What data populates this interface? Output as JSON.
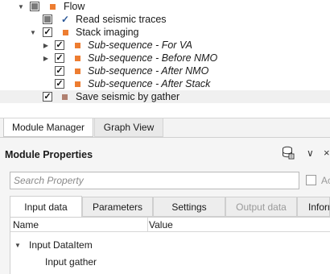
{
  "tree": {
    "items": [
      {
        "label": "Flow",
        "italic": false
      },
      {
        "label": "Read seismic traces",
        "italic": false
      },
      {
        "label": "Stack imaging",
        "italic": false
      },
      {
        "label": "Sub-sequence - For VA",
        "italic": true
      },
      {
        "label": "Sub-sequence - Before NMO",
        "italic": true
      },
      {
        "label": "Sub-sequence - After NMO",
        "italic": true
      },
      {
        "label": "Sub-sequence - After Stack",
        "italic": true
      },
      {
        "label": "Save seismic by gather",
        "italic": false
      }
    ],
    "square_color": "#ed7d31",
    "save_square_color": "#b08070"
  },
  "bottom_tabs": [
    {
      "label": "Module Manager",
      "active": true
    },
    {
      "label": "Graph View",
      "active": false
    }
  ],
  "module_properties": {
    "title": "Module Properties",
    "search_placeholder": "Search Property",
    "advanced_label": "Ac",
    "tabs": [
      {
        "label": "Input data",
        "active": true
      },
      {
        "label": "Parameters",
        "active": false
      },
      {
        "label": "Settings",
        "active": false
      },
      {
        "label": "Output data",
        "active": false,
        "disabled": true
      },
      {
        "label": "Inform",
        "active": false
      }
    ],
    "grid": {
      "columns": [
        "Name",
        "Value"
      ],
      "group": "Input DataItem",
      "rows": [
        {
          "name": "Input gather",
          "value": ""
        }
      ]
    }
  }
}
